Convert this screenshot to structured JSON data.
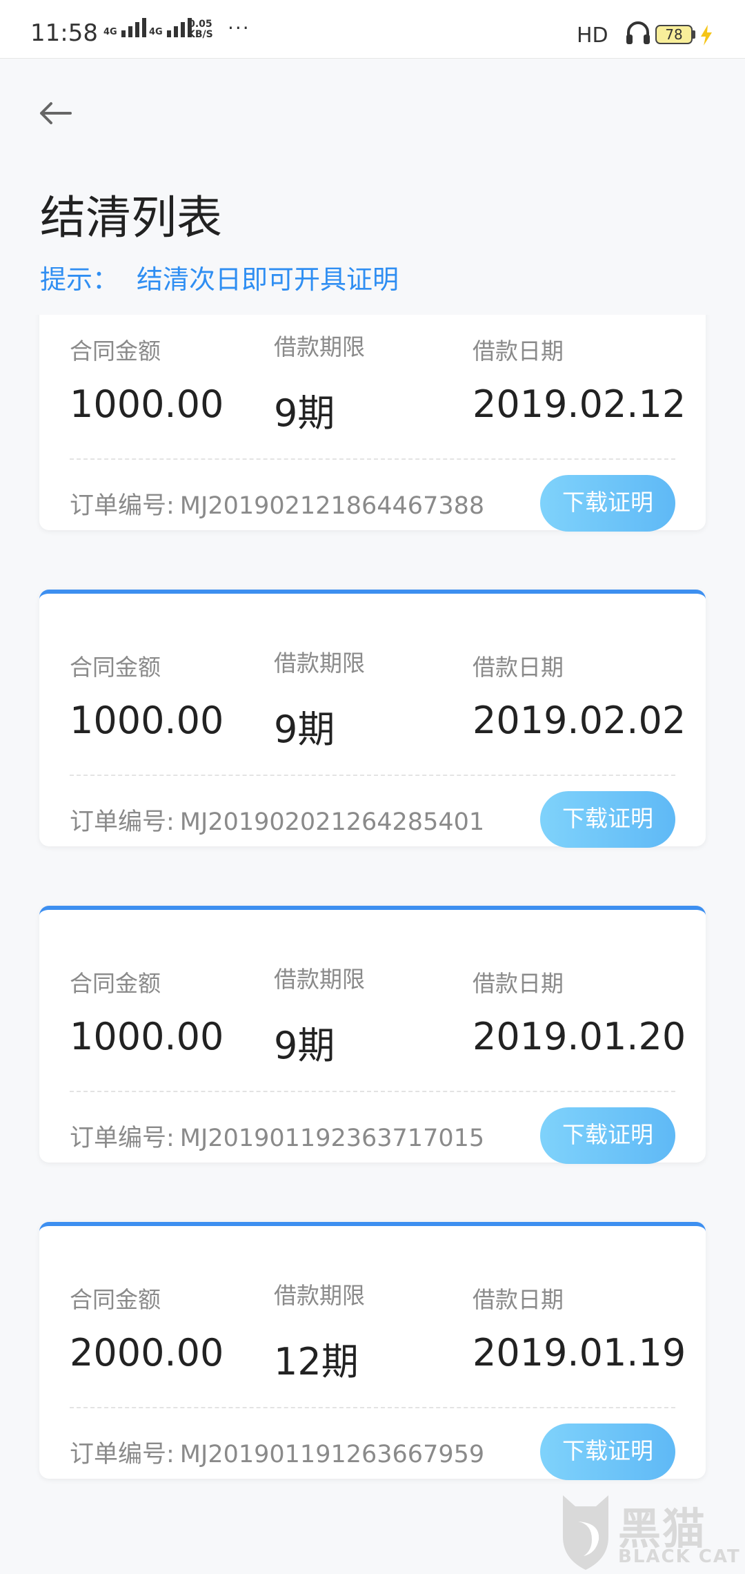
{
  "status_bar": {
    "time": "11:58",
    "signal1_label": "4G",
    "signal2_label": "4G",
    "net_speed_value": "0.05",
    "net_speed_unit": "KB/S",
    "more_dots": "···",
    "hd_label": "HD",
    "battery_level": "78",
    "icons": [
      "signal-icon",
      "signal-icon",
      "headset-icon",
      "battery-icon",
      "charging-icon"
    ]
  },
  "header": {
    "back_icon": "arrow-left-icon",
    "title": "结清列表",
    "tip_label": "提示：",
    "tip_text": "结清次日即可开具证明"
  },
  "labels": {
    "amount": "合同金额",
    "term": "借款期限",
    "date": "借款日期",
    "order_prefix": "订单编号:",
    "download_button": "下载证明"
  },
  "records": [
    {
      "amount": "1000.00",
      "term": "9期",
      "date": "2019.02.12",
      "order_no": "MJ201902121864467388"
    },
    {
      "amount": "1000.00",
      "term": "9期",
      "date": "2019.02.02",
      "order_no": "MJ201902021264285401"
    },
    {
      "amount": "1000.00",
      "term": "9期",
      "date": "2019.01.20",
      "order_no": "MJ201901192363717015"
    },
    {
      "amount": "2000.00",
      "term": "12期",
      "date": "2019.01.19",
      "order_no": "MJ201901191263667959"
    }
  ],
  "watermark": {
    "cn": "黑猫",
    "en": "BLACK CAT"
  },
  "colors": {
    "accent": "#2f8ef2",
    "card_top_border": "#3d8ff0",
    "button": "#6cc3f8",
    "muted_text": "#8a8a8a"
  }
}
